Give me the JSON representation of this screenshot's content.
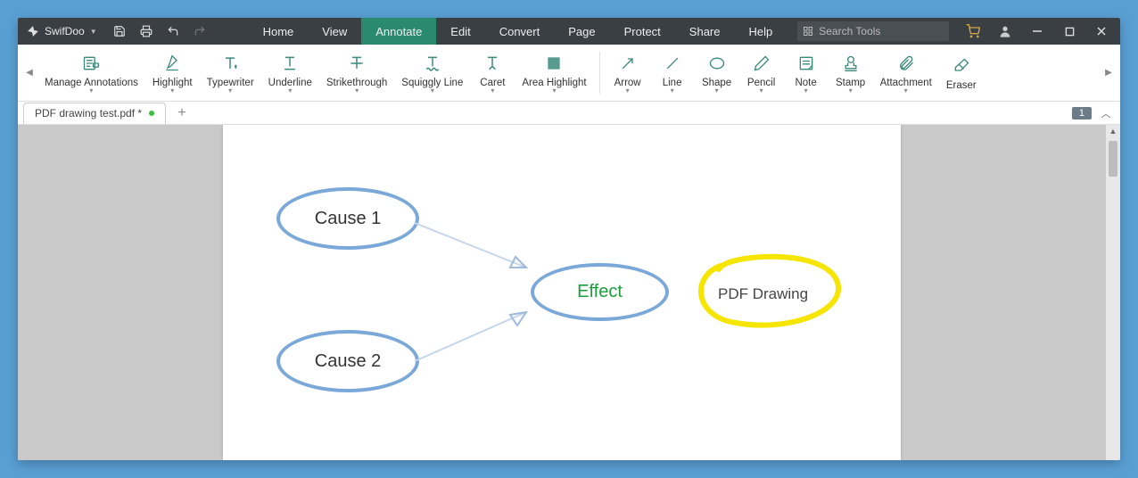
{
  "app": {
    "name": "SwifDoo"
  },
  "menu": {
    "items": [
      "Home",
      "View",
      "Annotate",
      "Edit",
      "Convert",
      "Page",
      "Protect",
      "Share",
      "Help"
    ],
    "active_index": 2
  },
  "search": {
    "placeholder": "Search Tools"
  },
  "ribbon": {
    "tools": [
      {
        "label": "Manage Annotations"
      },
      {
        "label": "Highlight"
      },
      {
        "label": "Typewriter"
      },
      {
        "label": "Underline"
      },
      {
        "label": "Strikethrough"
      },
      {
        "label": "Squiggly Line"
      },
      {
        "label": "Caret"
      },
      {
        "label": "Area Highlight"
      },
      {
        "label": "Arrow"
      },
      {
        "label": "Line"
      },
      {
        "label": "Shape"
      },
      {
        "label": "Pencil"
      },
      {
        "label": "Note"
      },
      {
        "label": "Stamp"
      },
      {
        "label": "Attachment"
      },
      {
        "label": "Eraser"
      }
    ]
  },
  "tab": {
    "filename": "PDF drawing test.pdf *"
  },
  "page_indicator": "1",
  "diagram": {
    "cause1": "Cause 1",
    "cause2": "Cause 2",
    "effect": "Effect",
    "annotation": "PDF Drawing"
  }
}
